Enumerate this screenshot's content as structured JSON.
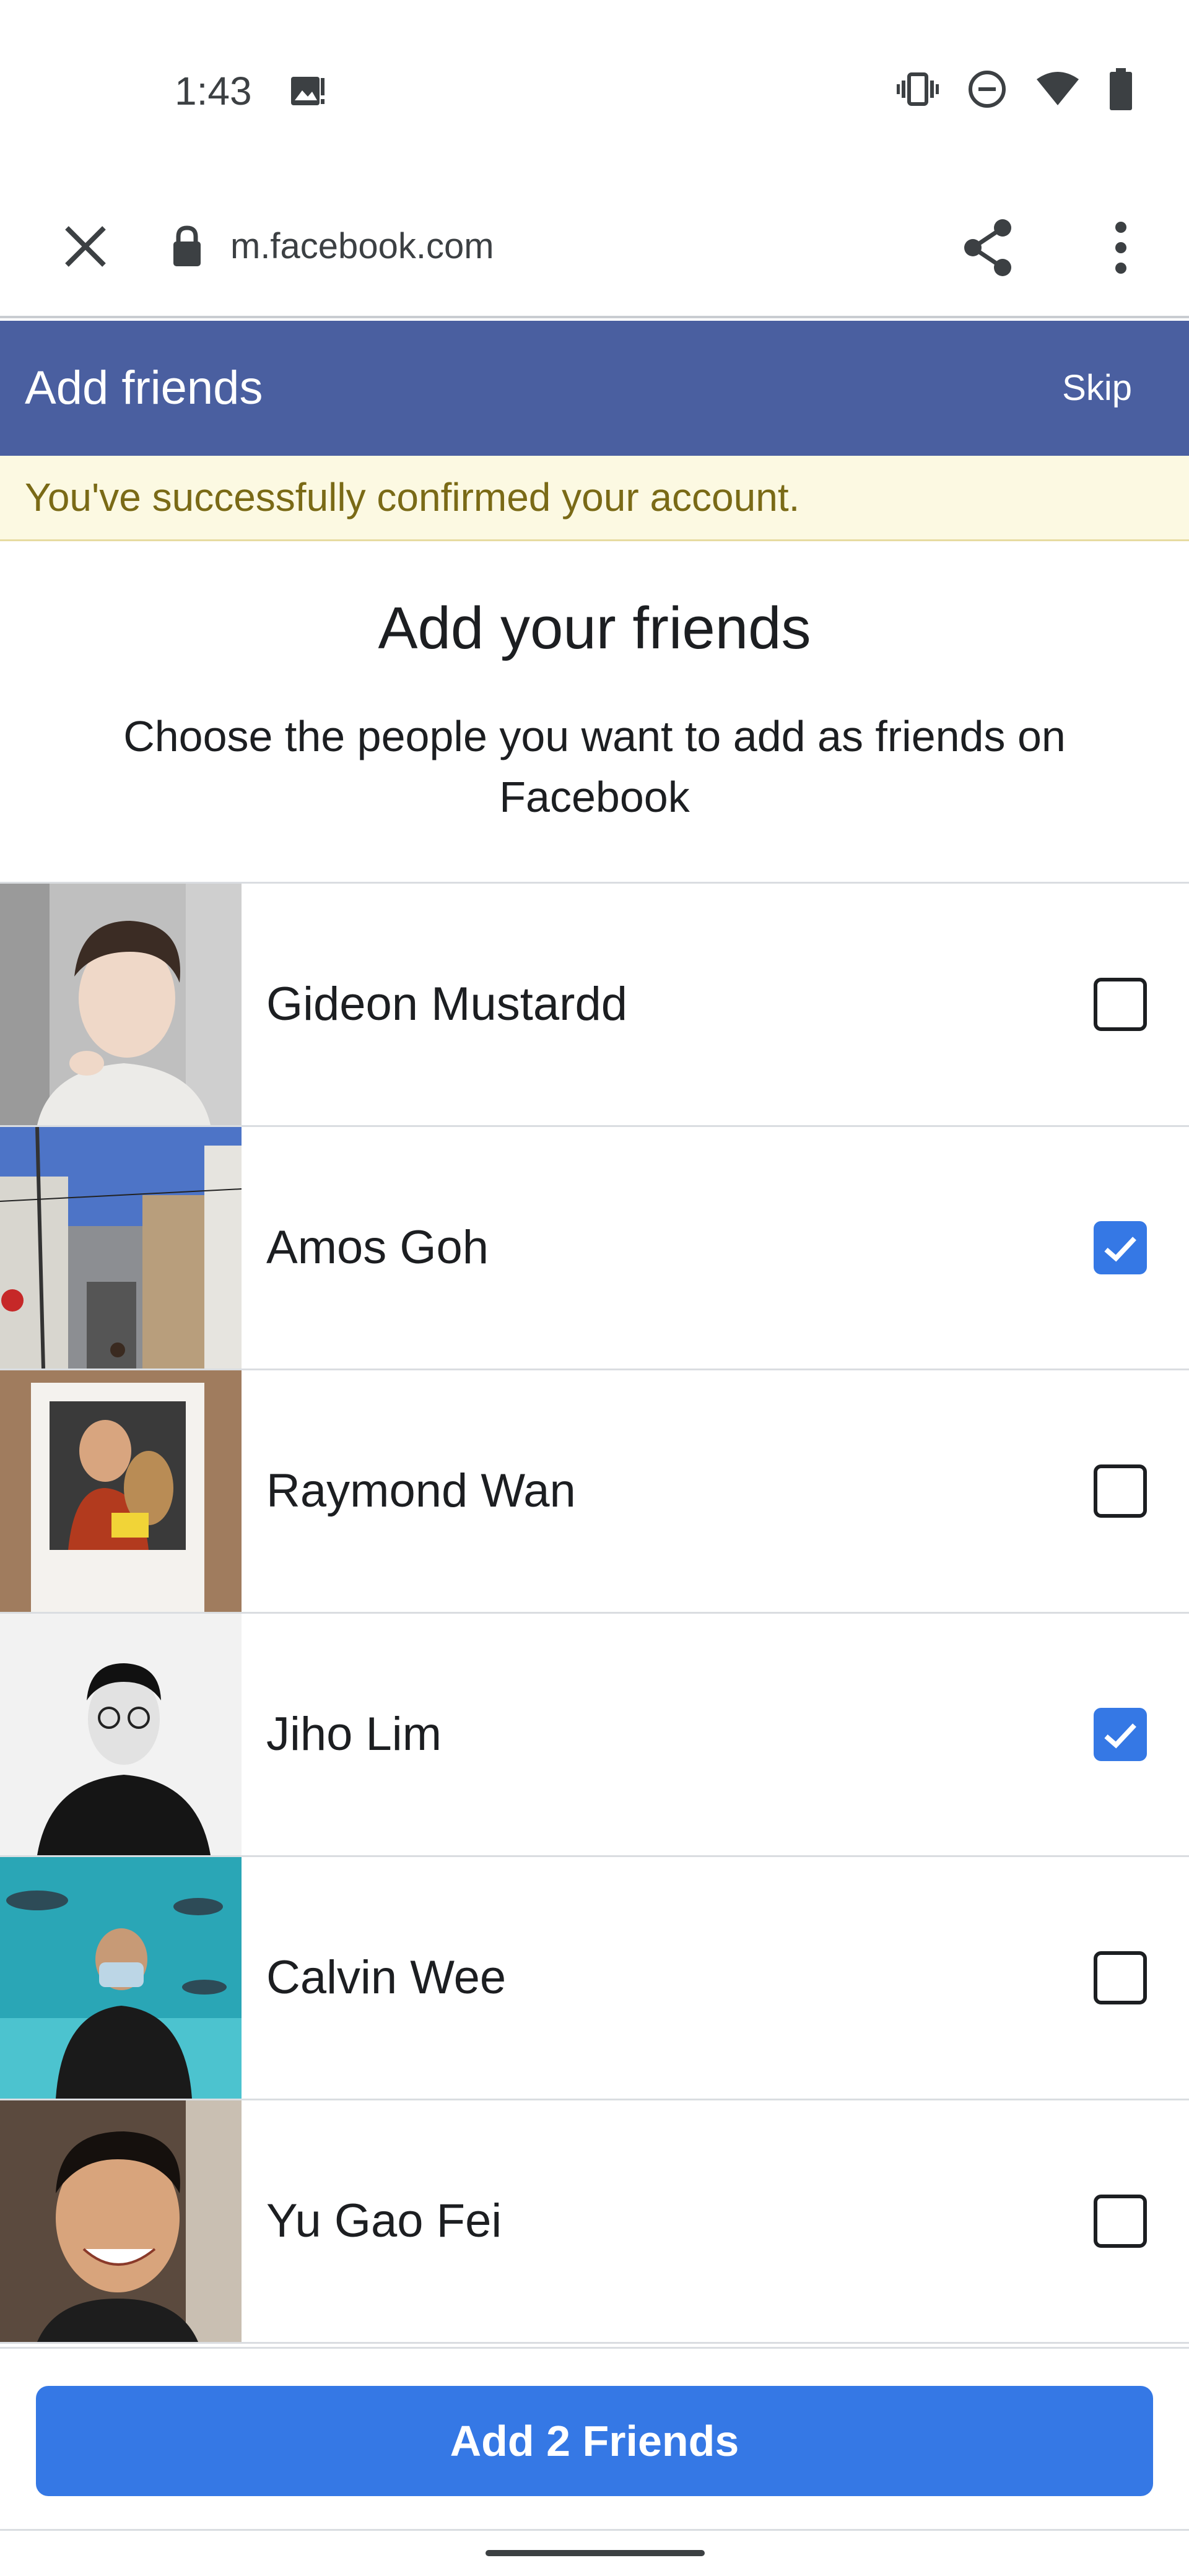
{
  "status_bar": {
    "time": "1:43",
    "icons": [
      "gallery-notification-icon",
      "vibrate-icon",
      "do-not-disturb-icon",
      "wifi-icon",
      "battery-icon"
    ]
  },
  "browser": {
    "url": "m.facebook.com",
    "icons": [
      "close-icon",
      "lock-icon",
      "share-icon",
      "more-vert-icon"
    ]
  },
  "header": {
    "title": "Add friends",
    "skip_label": "Skip",
    "color": "#4a5fa0"
  },
  "banner": {
    "message": "You've successfully confirmed your account."
  },
  "intro": {
    "heading": "Add your friends",
    "subheading": "Choose the people you want to add as friends on Facebook"
  },
  "friends": [
    {
      "name": "Gideon Mustardd",
      "checked": false
    },
    {
      "name": "Amos Goh",
      "checked": true
    },
    {
      "name": "Raymond Wan",
      "checked": false
    },
    {
      "name": "Jiho Lim",
      "checked": true
    },
    {
      "name": "Calvin Wee",
      "checked": false
    },
    {
      "name": "Yu Gao Fei",
      "checked": false
    }
  ],
  "footer": {
    "add_button_label": "Add 2 Friends",
    "button_color": "#3578e5"
  }
}
